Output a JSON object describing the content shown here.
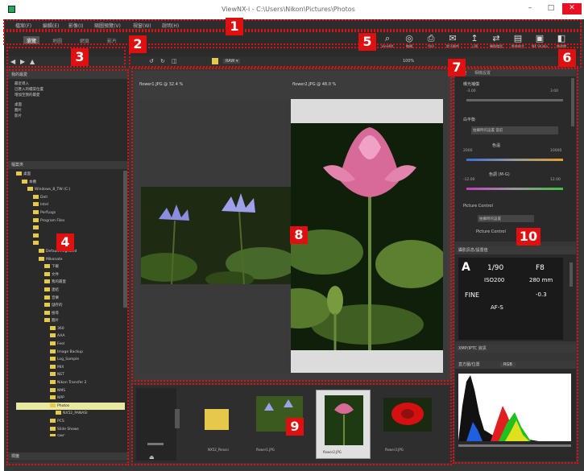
{
  "window": {
    "title": "ViewNX-i - C:\\Users\\Nikon\\Pictures\\Photos",
    "minimize": "–",
    "maximize": "□",
    "close": "✕"
  },
  "menu": [
    "檔案(F)",
    "編輯(E)",
    "影像(I)",
    "縮圖預覽(V)",
    "視窗(W)",
    "說明(H)"
  ],
  "tabs": [
    {
      "label": "瀏覽",
      "active": true
    },
    {
      "label": "地圖",
      "active": false
    },
    {
      "label": "網頁",
      "active": false
    },
    {
      "label": "影片",
      "active": false
    }
  ],
  "toolbar": [
    {
      "icon": "magnifier-icon",
      "glyph": "⌕",
      "label": "ViewNX"
    },
    {
      "icon": "edit-icon",
      "glyph": "◎",
      "label": "編輯"
    },
    {
      "icon": "print-icon",
      "glyph": "⎙",
      "label": "列印"
    },
    {
      "icon": "mail-icon",
      "glyph": "✉",
      "label": "電子郵件"
    },
    {
      "icon": "upload-icon",
      "glyph": "↥",
      "label": "上傳"
    },
    {
      "icon": "convert-icon",
      "glyph": "⇄",
      "label": "轉換檔案"
    },
    {
      "icon": "image-format-icon",
      "glyph": "▤",
      "label": "影像格式"
    },
    {
      "icon": "nx-studio-icon",
      "glyph": "▣",
      "label": "NX Studio"
    },
    {
      "icon": "sidebar-icon",
      "glyph": "◧",
      "label": "側邊欄"
    }
  ],
  "nav": {
    "zoom_label": "100%",
    "file_a": "flower1.JPG @ 32.4 %",
    "file_b": "flower2.JPG @ 48.0 %"
  },
  "favorites": {
    "header": "我的最愛",
    "items": [
      "最近導入",
      "已匯入的檔案位置",
      "增加至我的最愛"
    ],
    "items2": [
      "桌面",
      "圖片",
      "影片"
    ]
  },
  "folders": {
    "header": "檔案夾",
    "rows": [
      {
        "label": "桌面",
        "indent": 0,
        "sel": false
      },
      {
        "label": "本機",
        "indent": 1,
        "sel": false
      },
      {
        "label": "Windows_8_TW (C:)",
        "indent": 2,
        "sel": false
      },
      {
        "label": "Dell",
        "indent": 3,
        "sel": false
      },
      {
        "label": "Intel",
        "indent": 3,
        "sel": false
      },
      {
        "label": "PerfLogs",
        "indent": 3,
        "sel": false
      },
      {
        "label": "Program Files",
        "indent": 3,
        "sel": false
      },
      {
        "label": "",
        "indent": 3,
        "sel": false
      },
      {
        "label": "",
        "indent": 3,
        "sel": false
      },
      {
        "label": "",
        "indent": 3,
        "sel": false
      },
      {
        "label": "Default.migrated",
        "indent": 4,
        "sel": false
      },
      {
        "label": "Mikenate",
        "indent": 4,
        "sel": false
      },
      {
        "label": "下載",
        "indent": 5,
        "sel": false
      },
      {
        "label": "文件",
        "indent": 5,
        "sel": false
      },
      {
        "label": "我的最愛",
        "indent": 5,
        "sel": false
      },
      {
        "label": "連結",
        "indent": 5,
        "sel": false
      },
      {
        "label": "音樂",
        "indent": 5,
        "sel": false
      },
      {
        "label": "儲存的",
        "indent": 5,
        "sel": false
      },
      {
        "label": "搜尋",
        "indent": 5,
        "sel": false
      },
      {
        "label": "圖片",
        "indent": 5,
        "sel": false
      },
      {
        "label": "360",
        "indent": 6,
        "sel": false
      },
      {
        "label": "AAA",
        "indent": 6,
        "sel": false
      },
      {
        "label": "Feel",
        "indent": 6,
        "sel": false
      },
      {
        "label": "Image Backup",
        "indent": 6,
        "sel": false
      },
      {
        "label": "Log_Sample",
        "indent": 6,
        "sel": false
      },
      {
        "label": "MIX",
        "indent": 6,
        "sel": false
      },
      {
        "label": "NET",
        "indent": 6,
        "sel": false
      },
      {
        "label": "Nikon Transfer 2",
        "indent": 6,
        "sel": false
      },
      {
        "label": "NMS",
        "indent": 6,
        "sel": false
      },
      {
        "label": "NPP",
        "indent": 6,
        "sel": false
      },
      {
        "label": "Photos",
        "indent": 6,
        "sel": true
      },
      {
        "label": "NX52_PANASI",
        "indent": 7,
        "sel": false
      },
      {
        "label": "PCS",
        "indent": 6,
        "sel": false
      },
      {
        "label": "Slide Shows",
        "indent": 6,
        "sel": false
      },
      {
        "label": "SMC",
        "indent": 6,
        "sel": false
      },
      {
        "label": "SPS",
        "indent": 6,
        "sel": false
      }
    ],
    "footer": "標籤"
  },
  "adjust": {
    "tabs": [
      "調整",
      "相機設置"
    ],
    "exposure_label": "曝光補償",
    "exposure_min": "-3.00",
    "exposure_max": "3.00",
    "wb_label": "白平衡",
    "wb_value": "拍攝時的設置 當前",
    "temp_label": "色溫",
    "temp_min": "2000",
    "temp_max": "10000",
    "tint_label": "色調 (M-G)",
    "tint_min": "-12.00",
    "tint_max": "12.00",
    "picture_control": "Picture Control",
    "pc_value": "拍攝時的設置",
    "pc_label2": "Picture Control"
  },
  "info": {
    "header": "攝影訊息/設置值",
    "mode": "A",
    "shutter": "1/90",
    "aperture": "F8",
    "iso": "ISO200",
    "focal": "280 mm",
    "quality": "FINE",
    "ev": "-0.3",
    "af": "AF-S"
  },
  "xmp": {
    "header": "XMP/IPTC 資訊"
  },
  "histogram": {
    "header": "直方圖/位置",
    "channel": "RGB"
  },
  "thumbs": [
    {
      "name": "NX52_Panasi",
      "type": "folder"
    },
    {
      "name": "flower1.JPG",
      "type": "lily"
    },
    {
      "name": "flower2.JPG",
      "type": "pink"
    },
    {
      "name": "flower3.JPG",
      "type": "red"
    }
  ],
  "callouts": [
    "1",
    "2",
    "3",
    "4",
    "5",
    "6",
    "7",
    "8",
    "9",
    "10"
  ],
  "colors": {
    "accent_red": "#e01010",
    "selection": "#e8e8a0",
    "folder": "#e6c84a"
  }
}
